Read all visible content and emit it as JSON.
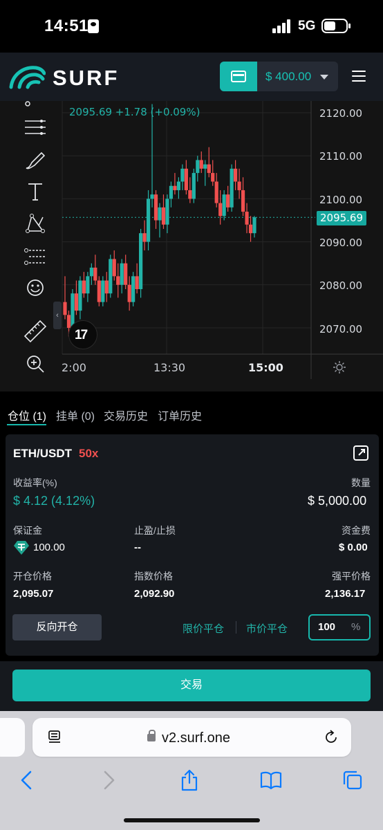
{
  "status_bar": {
    "time": "14:51",
    "network": "5G"
  },
  "header": {
    "logo_text": "SURF",
    "wallet_balance": "$ 400.00"
  },
  "chart": {
    "ohlc_text": "2095.69  +1.78 (+0.09%)",
    "current_price": "2095.69",
    "price_axis": [
      "2120.00",
      "2110.00",
      "2100.00",
      "2090.00",
      "2080.00",
      "2070.00"
    ],
    "time_axis": [
      "2:00",
      "13:30",
      "15:00"
    ],
    "colors": {
      "up": "#22b3a8",
      "down": "#f0504f"
    },
    "tools": [
      "magnet-icon",
      "horizontal-lines-icon",
      "brush-icon",
      "text-icon",
      "pattern-icon",
      "fib-icon",
      "emoji-icon",
      "ruler-icon",
      "zoom-in-icon"
    ]
  },
  "chart_data": {
    "type": "candlestick",
    "title": "",
    "xlabel": "",
    "ylabel": "",
    "ylim": [
      2065,
      2123
    ],
    "x_ticks": [
      "2:00",
      "13:30",
      "15:00"
    ],
    "y_ticks": [
      2070,
      2080,
      2090,
      2100,
      2110,
      2120
    ],
    "last_price": 2095.69,
    "change": 1.78,
    "change_pct": 0.09,
    "candles": [
      [
        2076,
        2082,
        2072,
        2073
      ],
      [
        2073,
        2074,
        2068,
        2070
      ],
      [
        2070,
        2079,
        2069,
        2078
      ],
      [
        2078,
        2081,
        2073,
        2074
      ],
      [
        2074,
        2082,
        2072,
        2081
      ],
      [
        2081,
        2083,
        2077,
        2078
      ],
      [
        2078,
        2083,
        2076,
        2082
      ],
      [
        2082,
        2085,
        2080,
        2084
      ],
      [
        2084,
        2087,
        2080,
        2081
      ],
      [
        2081,
        2082,
        2075,
        2076
      ],
      [
        2076,
        2082,
        2075,
        2081
      ],
      [
        2081,
        2083,
        2076,
        2078
      ],
      [
        2078,
        2087,
        2077,
        2086
      ],
      [
        2086,
        2088,
        2081,
        2082
      ],
      [
        2082,
        2085,
        2077,
        2080
      ],
      [
        2080,
        2086,
        2078,
        2085
      ],
      [
        2085,
        2087,
        2079,
        2080
      ],
      [
        2080,
        2082,
        2074,
        2076
      ],
      [
        2076,
        2083,
        2075,
        2082
      ],
      [
        2082,
        2085,
        2078,
        2079
      ],
      [
        2079,
        2093,
        2077,
        2092
      ],
      [
        2092,
        2095,
        2088,
        2090
      ],
      [
        2090,
        2102,
        2088,
        2100
      ],
      [
        2100,
        2122,
        2098,
        2101
      ],
      [
        2101,
        2102,
        2093,
        2095
      ],
      [
        2095,
        2099,
        2091,
        2098
      ],
      [
        2098,
        2101,
        2093,
        2094
      ],
      [
        2094,
        2101,
        2092,
        2100
      ],
      [
        2100,
        2104,
        2098,
        2103
      ],
      [
        2103,
        2106,
        2101,
        2102
      ],
      [
        2102,
        2105,
        2100,
        2104
      ],
      [
        2104,
        2108,
        2102,
        2107
      ],
      [
        2107,
        2109,
        2101,
        2102
      ],
      [
        2102,
        2105,
        2099,
        2100
      ],
      [
        2100,
        2107,
        2099,
        2106
      ],
      [
        2106,
        2110,
        2104,
        2109
      ],
      [
        2109,
        2111,
        2106,
        2107
      ],
      [
        2107,
        2109,
        2103,
        2108
      ],
      [
        2108,
        2112,
        2105,
        2106
      ],
      [
        2106,
        2109,
        2103,
        2104
      ],
      [
        2104,
        2106,
        2098,
        2099
      ],
      [
        2099,
        2102,
        2094,
        2096
      ],
      [
        2096,
        2102,
        2095,
        2101
      ],
      [
        2101,
        2103,
        2097,
        2098
      ],
      [
        2098,
        2108,
        2097,
        2107
      ],
      [
        2107,
        2109,
        2102,
        2104
      ],
      [
        2104,
        2107,
        2100,
        2102
      ],
      [
        2102,
        2105,
        2096,
        2097
      ],
      [
        2097,
        2099,
        2092,
        2094
      ],
      [
        2094,
        2096,
        2090,
        2092
      ],
      [
        2092,
        2096,
        2091,
        2095.69
      ]
    ]
  },
  "tabs": [
    {
      "label": "仓位 (1)",
      "active": true
    },
    {
      "label": "挂单 (0)",
      "active": false
    },
    {
      "label": "交易历史",
      "active": false
    },
    {
      "label": "订单历史",
      "active": false
    }
  ],
  "position": {
    "pair": "ETH/USDT",
    "leverage": "50x",
    "pnl_label": "收益率(%)",
    "pnl_value": "$ 4.12  (4.12%)",
    "quantity_label": "数量",
    "quantity_value": "$ 5,000.00",
    "margin_label": "保证金",
    "margin_value": "100.00",
    "tpsl_label": "止盈/止损",
    "tpsl_value": "--",
    "funding_label": "资金费",
    "funding_value": "$ 0.00",
    "entry_label": "开仓价格",
    "entry_value": "2,095.07",
    "index_label": "指数价格",
    "index_value": "2,092.90",
    "liq_label": "强平价格",
    "liq_value": "2,136.17",
    "reverse_label": "反向开仓",
    "limit_close_label": "限价平仓",
    "market_close_label": "市价平仓",
    "close_pct_value": "100",
    "close_pct_unit": "%"
  },
  "trade_button": "交易",
  "browser": {
    "url": "v2.surf.one"
  }
}
